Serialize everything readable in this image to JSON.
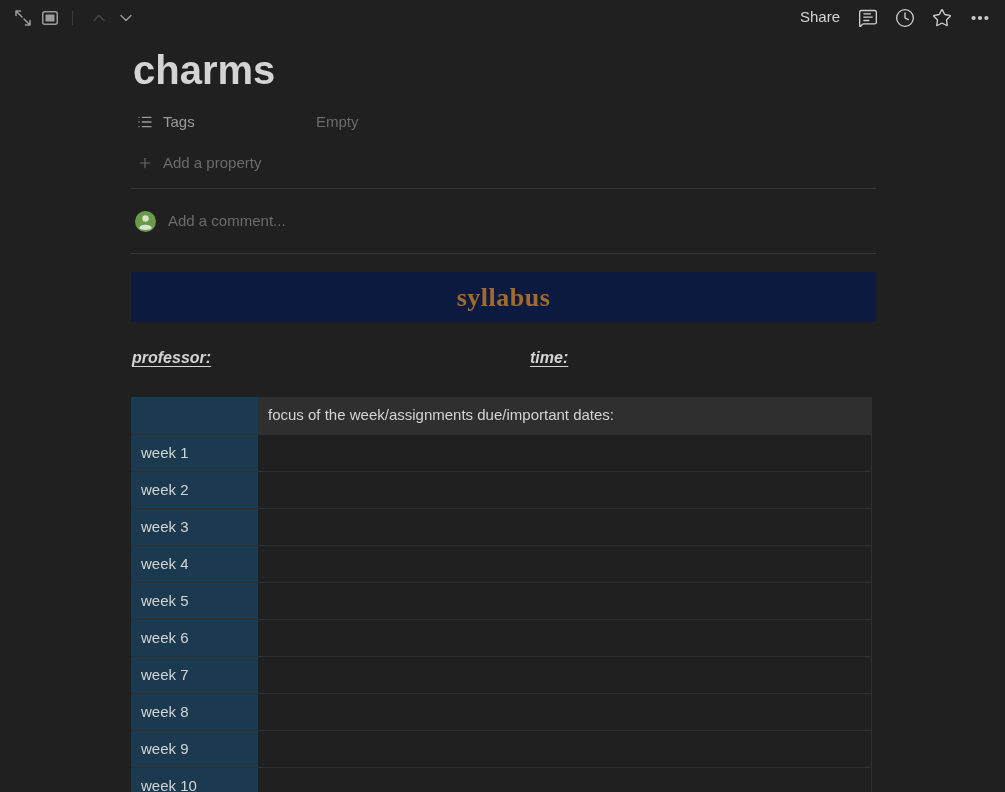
{
  "toolbar": {
    "page_nav": [
      {
        "kind": "up",
        "disabled": true
      },
      {
        "kind": "down",
        "disabled": false
      }
    ],
    "share": "Share"
  },
  "title": "charms",
  "properties": [
    {
      "name": "Tags",
      "value": "Empty"
    }
  ],
  "add_property": "Add a property",
  "comment": {
    "placeholder": "Add a comment..."
  },
  "banner": "syllabus",
  "fields": [
    "professor:",
    "time:"
  ],
  "table": {
    "header": "focus of the week/assignments due/important dates:",
    "rows": [
      "week 1",
      "week 2",
      "week 3",
      "week 4",
      "week 5",
      "week 6",
      "week 7",
      "week 8",
      "week 9",
      "week 10"
    ]
  }
}
